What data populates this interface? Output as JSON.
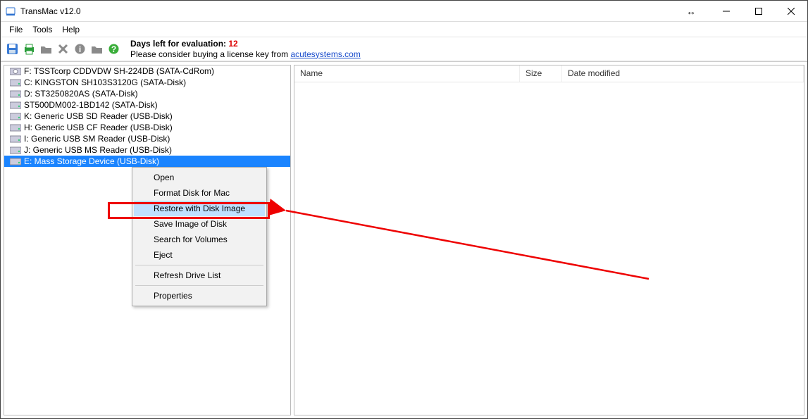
{
  "window": {
    "title": "TransMac v12.0"
  },
  "menu": {
    "file": "File",
    "tools": "Tools",
    "help": "Help"
  },
  "eval": {
    "days_prefix": "Days left for evaluation: ",
    "days_value": "12",
    "line2_prefix": "Please consider buying a license key from ",
    "link_text": "acutesystems.com"
  },
  "columns": {
    "name": "Name",
    "size": "Size",
    "date": "Date modified"
  },
  "tree": [
    {
      "label": "F: TSSTcorp CDDVDW SH-224DB (SATA-CdRom)",
      "type": "cdrom"
    },
    {
      "label": "C:  KINGSTON SH103S3120G (SATA-Disk)",
      "type": "disk"
    },
    {
      "label": "D:  ST3250820AS (SATA-Disk)",
      "type": "disk"
    },
    {
      "label": "    ST500DM002-1BD142 (SATA-Disk)",
      "type": "disk"
    },
    {
      "label": "K: Generic USB SD Reader (USB-Disk)",
      "type": "disk"
    },
    {
      "label": "H: Generic USB CF Reader (USB-Disk)",
      "type": "disk"
    },
    {
      "label": "I: Generic USB SM Reader (USB-Disk)",
      "type": "disk"
    },
    {
      "label": "J: Generic USB MS Reader (USB-Disk)",
      "type": "disk"
    },
    {
      "label": "E: Mass Storage Device (USB-Disk)",
      "type": "disk",
      "selected": true
    }
  ],
  "context_menu": {
    "open": "Open",
    "format": "Format Disk for Mac",
    "restore": "Restore with Disk Image",
    "save": "Save Image of Disk",
    "search": "Search for Volumes",
    "eject": "Eject",
    "refresh": "Refresh Drive List",
    "properties": "Properties"
  }
}
